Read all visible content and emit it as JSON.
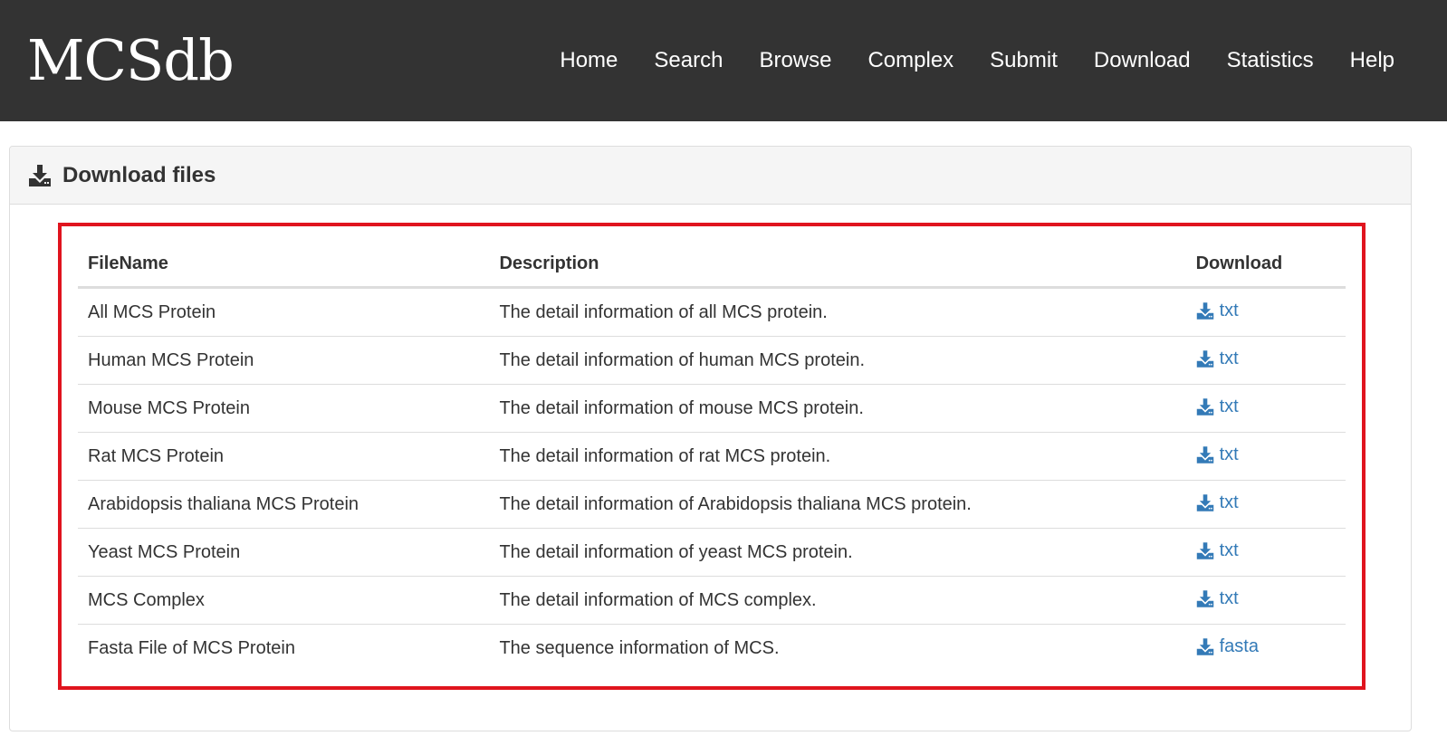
{
  "brand": "MCSdb",
  "nav": [
    {
      "label": "Home"
    },
    {
      "label": "Search"
    },
    {
      "label": "Browse"
    },
    {
      "label": "Complex"
    },
    {
      "label": "Submit"
    },
    {
      "label": "Download"
    },
    {
      "label": "Statistics"
    },
    {
      "label": "Help"
    }
  ],
  "panel": {
    "icon": "download-icon",
    "title": "Download files"
  },
  "table": {
    "headers": {
      "filename": "FileName",
      "description": "Description",
      "download": "Download"
    },
    "rows": [
      {
        "filename": "All MCS Protein",
        "description": "The detail information of all MCS protein.",
        "link": "txt"
      },
      {
        "filename": "Human MCS Protein",
        "description": "The detail information of human MCS protein.",
        "link": "txt"
      },
      {
        "filename": "Mouse MCS Protein",
        "description": "The detail information of mouse MCS protein.",
        "link": "txt"
      },
      {
        "filename": "Rat MCS Protein",
        "description": "The detail information of rat MCS protein.",
        "link": "txt"
      },
      {
        "filename": "Arabidopsis thaliana MCS Protein",
        "description": "The detail information of Arabidopsis thaliana MCS protein.",
        "link": "txt"
      },
      {
        "filename": "Yeast MCS Protein",
        "description": "The detail information of yeast MCS protein.",
        "link": "txt"
      },
      {
        "filename": "MCS Complex",
        "description": "The detail information of MCS complex.",
        "link": "txt"
      },
      {
        "filename": "Fasta File of MCS Protein",
        "description": "The sequence information of MCS.",
        "link": "fasta"
      }
    ]
  },
  "colors": {
    "navbar": "#333333",
    "link": "#337ab7",
    "highlight": "#e0141e"
  }
}
